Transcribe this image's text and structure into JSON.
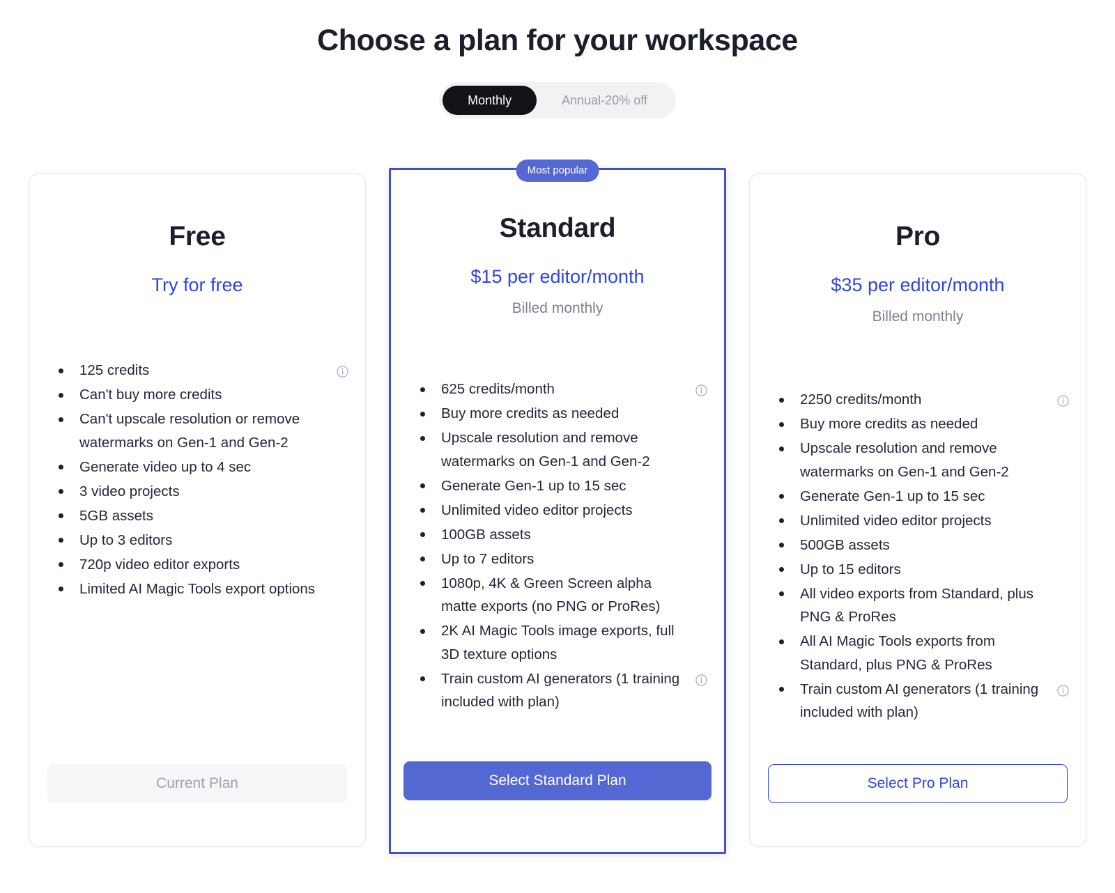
{
  "header": {
    "title": "Choose a plan for your workspace"
  },
  "billing_toggle": {
    "monthly_label": "Monthly",
    "annual_label": "Annual-20% off",
    "selected": "Monthly"
  },
  "badge": {
    "most_popular": "Most popular"
  },
  "colors": {
    "accent_blue": "#3045e0",
    "button_blue": "#5468d4",
    "featured_border": "#3f51cf",
    "toggle_active_bg": "#121218",
    "muted_text": "#7d8090"
  },
  "icons": {
    "info": "info-icon"
  },
  "plans": [
    {
      "name": "Free",
      "price": "Try for free",
      "billing": "",
      "featured": false,
      "badge": "",
      "features": [
        {
          "text": "125 credits",
          "info": true
        },
        {
          "text": "Can't buy more credits",
          "info": false
        },
        {
          "text": "Can't upscale resolution or remove watermarks on Gen-1 and Gen-2",
          "info": false
        },
        {
          "text": "Generate video up to 4 sec",
          "info": false
        },
        {
          "text": "3 video projects",
          "info": false
        },
        {
          "text": "5GB assets",
          "info": false
        },
        {
          "text": "Up to 3 editors",
          "info": false
        },
        {
          "text": "720p video editor exports",
          "info": false
        },
        {
          "text": "Limited AI Magic Tools export options",
          "info": false
        }
      ],
      "cta": {
        "label": "Current Plan",
        "style": "disabled"
      }
    },
    {
      "name": "Standard",
      "price": "$15 per editor/month",
      "billing": "Billed monthly",
      "featured": true,
      "badge": "Most popular",
      "features": [
        {
          "text": "625 credits/month",
          "info": true
        },
        {
          "text": "Buy more credits as needed",
          "info": false
        },
        {
          "text": "Upscale resolution and remove watermarks on Gen-1 and Gen-2",
          "info": false
        },
        {
          "text": "Generate Gen-1 up to 15 sec",
          "info": false
        },
        {
          "text": "Unlimited video editor projects",
          "info": false
        },
        {
          "text": "100GB assets",
          "info": false
        },
        {
          "text": "Up to 7 editors",
          "info": false
        },
        {
          "text": "1080p, 4K & Green Screen alpha matte exports (no PNG or ProRes)",
          "info": false
        },
        {
          "text": "2K AI Magic Tools image exports, full 3D texture options",
          "info": false
        },
        {
          "text": "Train custom AI generators (1 training included with plan)",
          "info": true
        }
      ],
      "cta": {
        "label": "Select Standard Plan",
        "style": "primary"
      }
    },
    {
      "name": "Pro",
      "price": "$35 per editor/month",
      "billing": "Billed monthly",
      "featured": false,
      "badge": "",
      "features": [
        {
          "text": "2250 credits/month",
          "info": true
        },
        {
          "text": "Buy more credits as needed",
          "info": false
        },
        {
          "text": "Upscale resolution and remove watermarks on Gen-1 and Gen-2",
          "info": false
        },
        {
          "text": "Generate Gen-1 up to 15 sec",
          "info": false
        },
        {
          "text": "Unlimited video editor projects",
          "info": false
        },
        {
          "text": "500GB assets",
          "info": false
        },
        {
          "text": "Up to 15 editors",
          "info": false
        },
        {
          "text": "All video exports from Standard, plus PNG & ProRes",
          "info": false
        },
        {
          "text": "All AI Magic Tools exports from Standard, plus PNG & ProRes",
          "info": false
        },
        {
          "text": "Train custom AI generators (1 training included with plan)",
          "info": true
        }
      ],
      "cta": {
        "label": "Select Pro Plan",
        "style": "outline"
      }
    }
  ]
}
